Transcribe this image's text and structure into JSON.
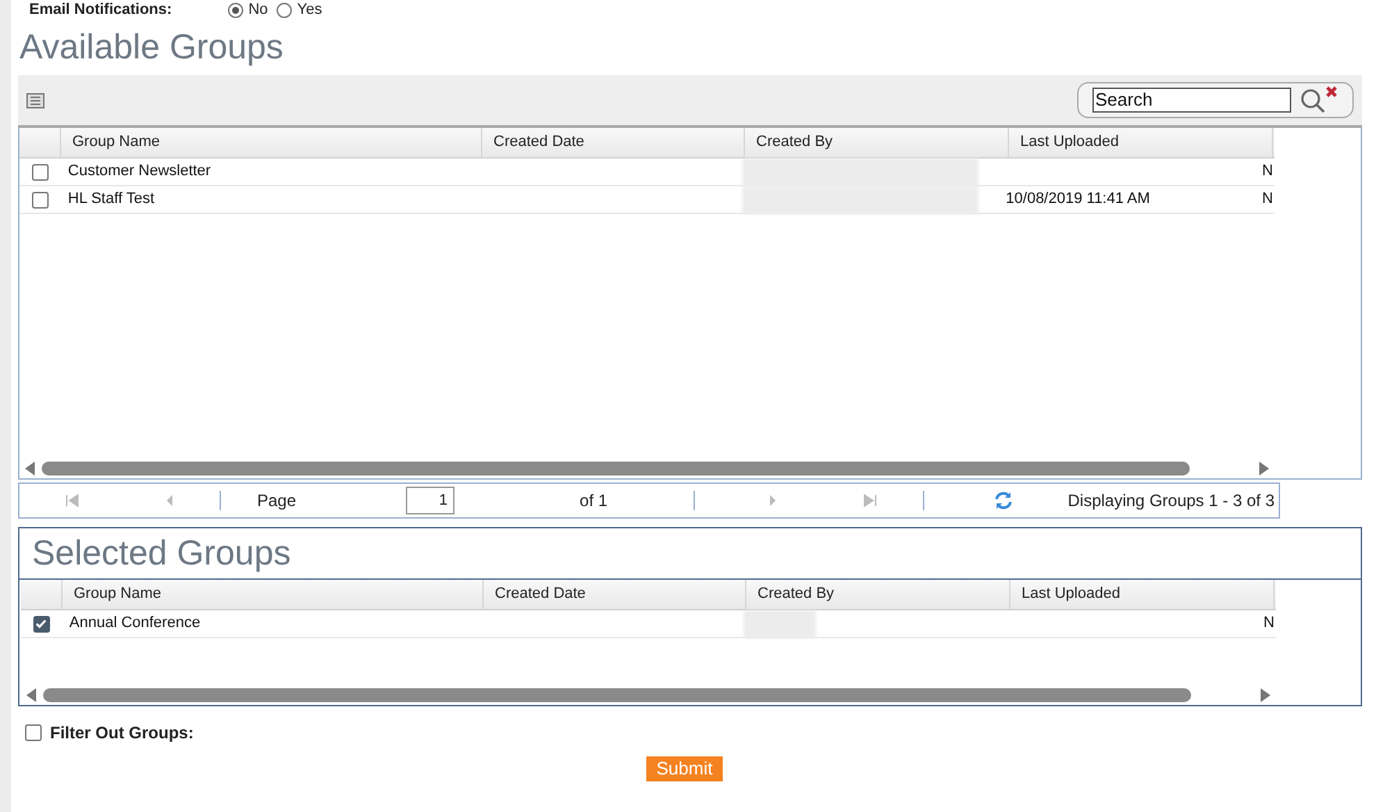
{
  "email_notifications": {
    "label": "Email Notifications:",
    "options": [
      {
        "label": "No",
        "selected": true
      },
      {
        "label": "Yes",
        "selected": false
      }
    ]
  },
  "available_groups": {
    "title": "Available Groups",
    "search": {
      "value": "Search"
    },
    "columns": [
      "Group Name",
      "Created Date",
      "Created By",
      "Last Uploaded"
    ],
    "rows": [
      {
        "checked": false,
        "group_name": "Customer Newsletter",
        "created_date": "",
        "last_uploaded": "",
        "column_5": "N"
      },
      {
        "checked": false,
        "group_name": "HL Staff Test",
        "created_date": "",
        "last_uploaded": "10/08/2019 11:41 AM",
        "column_5": "N"
      }
    ],
    "pager": {
      "page_label": "Page",
      "page_value": "1",
      "of": "of 1",
      "status": "Displaying Groups 1 - 3 of 3"
    }
  },
  "selected_groups": {
    "title": "Selected Groups",
    "columns": [
      "Group Name",
      "Created Date",
      "Created By",
      "Last Uploaded"
    ],
    "rows": [
      {
        "checked": true,
        "group_name": "Annual Conference",
        "created_date": "",
        "last_uploaded": "",
        "column_5": "N"
      }
    ]
  },
  "filter_out_groups": {
    "label": "Filter Out Groups:",
    "checked": false
  },
  "submit": "Submit"
}
